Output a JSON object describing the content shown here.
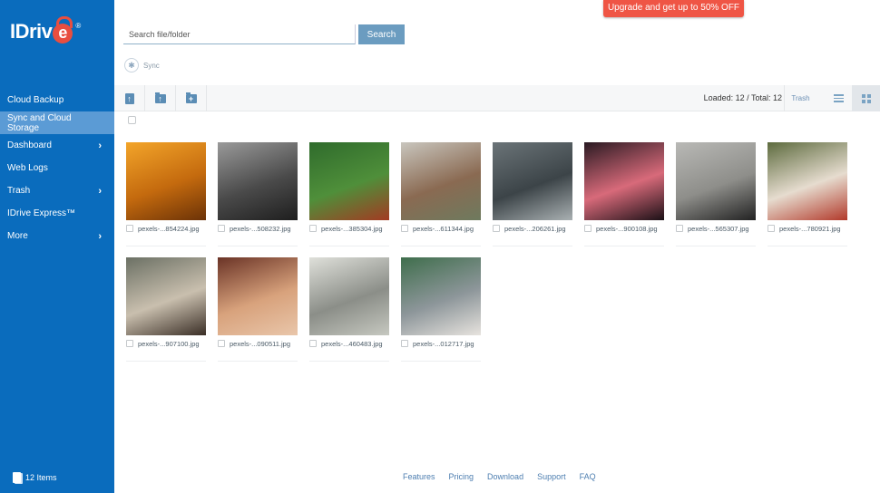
{
  "brand": {
    "logo_text": "IDriv",
    "logo_e": "e",
    "logo_reg": "®"
  },
  "sidebar": {
    "items": [
      {
        "label": "Cloud Backup",
        "chevron": ""
      },
      {
        "label": "Sync and Cloud Storage",
        "chevron": "",
        "active": true
      },
      {
        "label": "Dashboard",
        "chevron": "›"
      },
      {
        "label": "Web Logs",
        "chevron": ""
      },
      {
        "label": "Trash",
        "chevron": "›"
      },
      {
        "label": "IDrive Express™",
        "chevron": ""
      },
      {
        "label": "More",
        "chevron": "›"
      }
    ],
    "items_count": "12 Items"
  },
  "header": {
    "upgrade_label": "Upgrade and get up to 50% OFF",
    "search_placeholder": "Search file/folder",
    "search_value": "",
    "search_button": "Search",
    "breadcrumb_sync": "Sync",
    "sync_icon_glyph": "✱"
  },
  "toolbar": {
    "upload_file_glyph": "↑",
    "upload_folder_glyph": "↑",
    "new_folder_glyph": "+",
    "loaded_text": "Loaded: 12 / Total: 12",
    "trash_label": "Trash",
    "view_mode": "grid"
  },
  "files": [
    {
      "name": "pexels-...854224.jpg",
      "colors": [
        "#f3a52a",
        "#c46a0e",
        "#6b3207"
      ]
    },
    {
      "name": "pexels-...508232.jpg",
      "colors": [
        "#9a9a9a",
        "#4a4a4a",
        "#1e1e1e"
      ]
    },
    {
      "name": "pexels-...385304.jpg",
      "colors": [
        "#2f6b2c",
        "#4f8f3a",
        "#a33a22"
      ]
    },
    {
      "name": "pexels-...611344.jpg",
      "colors": [
        "#c9c6be",
        "#8a6a52",
        "#6e7a5e"
      ]
    },
    {
      "name": "pexels-...206261.jpg",
      "colors": [
        "#6b7478",
        "#3c4448",
        "#a9b0b2"
      ]
    },
    {
      "name": "pexels-...900108.jpg",
      "colors": [
        "#2a1a22",
        "#d86a7a",
        "#1b1016"
      ]
    },
    {
      "name": "pexels-...565307.jpg",
      "colors": [
        "#b9b9b6",
        "#8e8e8a",
        "#222222"
      ]
    },
    {
      "name": "pexels-...780921.jpg",
      "colors": [
        "#5d6b3e",
        "#e6dccf",
        "#b2392a"
      ]
    },
    {
      "name": "pexels-...907100.jpg",
      "colors": [
        "#6b7064",
        "#c9bfae",
        "#3a2e26"
      ]
    },
    {
      "name": "pexels-...090511.jpg",
      "colors": [
        "#6a3326",
        "#d8a27c",
        "#e9c6aa"
      ]
    },
    {
      "name": "pexels-...460483.jpg",
      "colors": [
        "#dfe0da",
        "#8b8e88",
        "#c6c8c0"
      ]
    },
    {
      "name": "pexels-...012717.jpg",
      "colors": [
        "#3f6e4c",
        "#8d969a",
        "#e7e3de"
      ]
    }
  ],
  "footer": {
    "links": [
      "Features",
      "Pricing",
      "Download",
      "Support",
      "FAQ"
    ]
  }
}
